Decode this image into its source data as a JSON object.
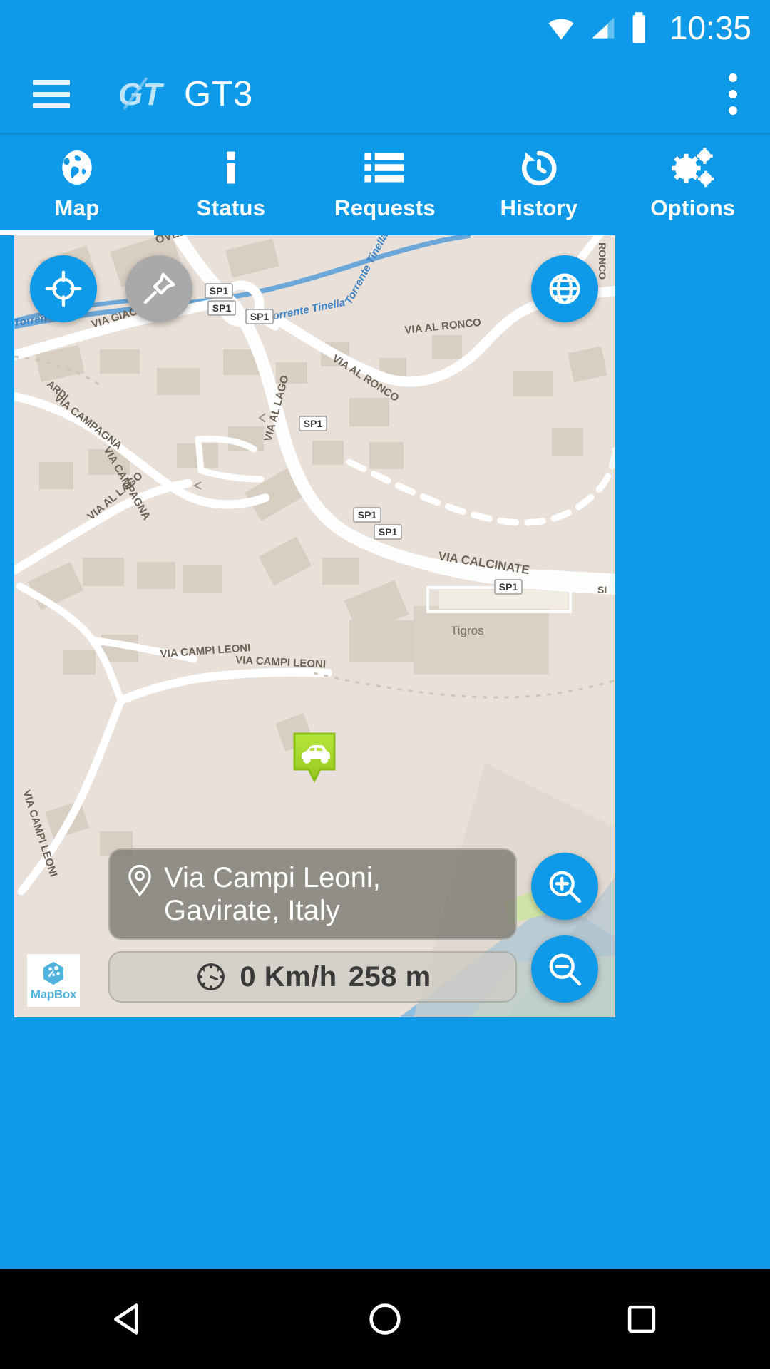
{
  "status_bar": {
    "time": "10:35",
    "icons": [
      "wifi-icon",
      "cellular-signal-icon",
      "battery-icon"
    ]
  },
  "app_bar": {
    "menu_icon": "hamburger-menu-icon",
    "logo_text": "GT",
    "title": "GT3",
    "overflow_icon": "more-vertical-icon"
  },
  "tabs": [
    {
      "label": "Map",
      "icon": "globe-icon",
      "active": true
    },
    {
      "label": "Status",
      "icon": "info-icon",
      "active": false
    },
    {
      "label": "Requests",
      "icon": "list-icon",
      "active": false
    },
    {
      "label": "History",
      "icon": "history-clock-icon",
      "active": false
    },
    {
      "label": "Options",
      "icon": "gears-icon",
      "active": false
    }
  ],
  "map": {
    "controls": {
      "locate": {
        "icon": "crosshair-target-icon",
        "state": "enabled",
        "color": "#0e9ae8"
      },
      "pin": {
        "icon": "push-pin-icon",
        "state": "disabled",
        "color": "#a9a9a9"
      },
      "layers": {
        "icon": "globe-grid-icon",
        "state": "enabled",
        "color": "#0e9ae8"
      },
      "zoom_in": {
        "icon": "magnifier-plus-icon",
        "state": "enabled",
        "color": "#0e9ae8"
      },
      "zoom_out": {
        "icon": "magnifier-minus-icon",
        "state": "enabled",
        "color": "#0e9ae8"
      }
    },
    "vehicle_marker": {
      "icon": "car-marker-icon",
      "color": "#a6d92a"
    },
    "address": {
      "icon": "location-pin-icon",
      "text": "Via Campi Leoni, Gavirate, Italy"
    },
    "telemetry": {
      "icon": "speedometer-icon",
      "speed": "0 Km/h",
      "accuracy": "258 m"
    },
    "attribution": {
      "name": "MapBox",
      "icon": "mapbox-logo-icon"
    },
    "street_labels": [
      "VIA GIACOMO",
      "VIA CAMPAGNA",
      "VIA CAMPAGNA",
      "VIA AL LAGO",
      "VIA AL LAGO",
      "VIA AL RONCO",
      "VIA AL RONCO",
      "VIA CALCINATE",
      "VIA CAMPI LEONI",
      "VIA CAMPI LEONI",
      "VIA CAMPI LEONI",
      "RONCO",
      "OVERA",
      "ARDI"
    ],
    "water_labels": [
      "Torrente Tinella",
      "Torrente Tinella",
      "Torrent"
    ],
    "poi_labels": [
      "Tigros"
    ],
    "shields": [
      "SP1",
      "SP1",
      "SP1",
      "SP1",
      "SP1",
      "SP1",
      "SP1"
    ]
  },
  "nav_bar": {
    "back": "back-triangle-icon",
    "home": "home-circle-icon",
    "recents": "recents-square-icon"
  },
  "colors": {
    "brand_blue": "#0e9ae8",
    "map_land": "#e8e0d8",
    "map_road": "#ffffff",
    "map_building": "#d8cec2",
    "map_water": "#78b4de",
    "marker_green": "#a6d92a",
    "nav_black": "#000000"
  }
}
